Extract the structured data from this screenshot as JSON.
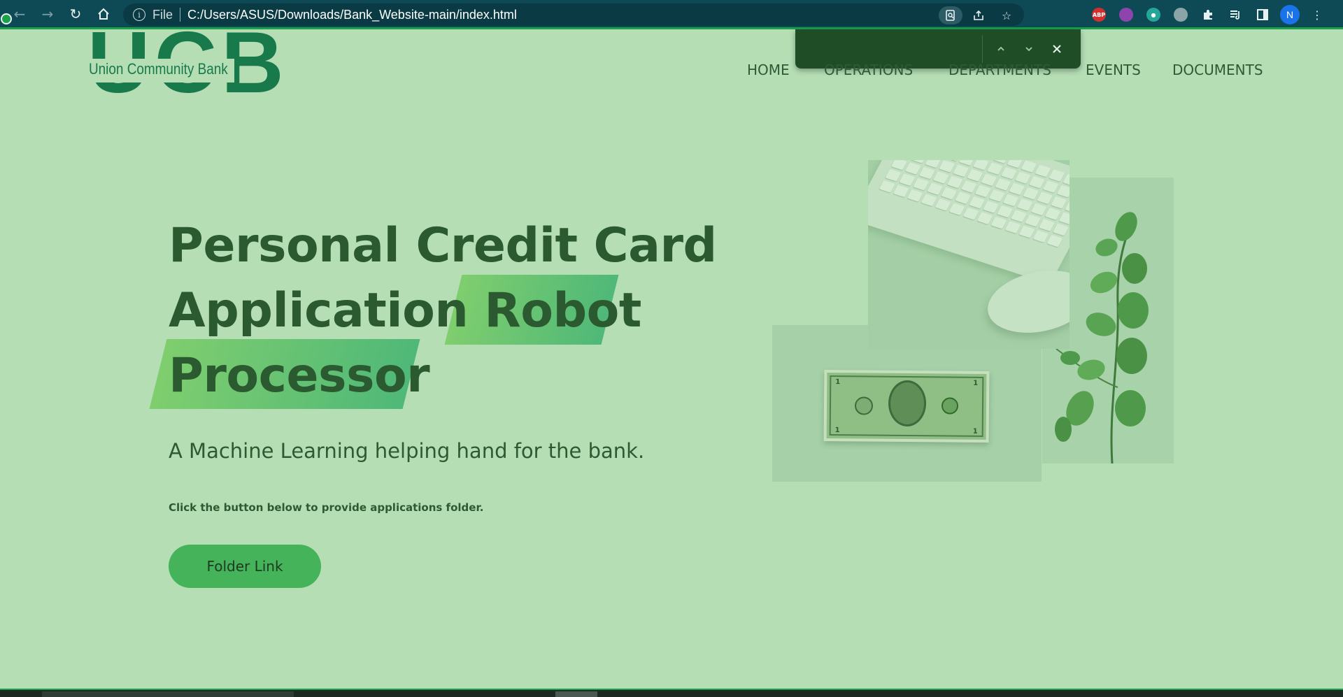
{
  "browser": {
    "back_icon": "arrow-left-icon",
    "forward_icon": "arrow-right-icon",
    "reload_icon": "reload-icon",
    "home_icon": "home-icon",
    "url_scheme_label": "File",
    "url": "C:/Users/ASUS/Downloads/Bank_Website-main/index.html",
    "profile_initial": "N",
    "extensions": [
      "ABP",
      "pocket",
      "lock",
      "globe",
      "puzzle",
      "media",
      "sidebar"
    ]
  },
  "find_bar": {
    "query": "",
    "prev_icon": "chevron-up-icon",
    "next_icon": "chevron-down-icon",
    "close_icon": "close-icon"
  },
  "site": {
    "logo_letters": "UCB",
    "logo_name": "Union Community Bank",
    "nav": [
      "HOME",
      "OPERATIONS",
      "DEPARTMENTS",
      "EVENTS",
      "DOCUMENTS"
    ]
  },
  "hero": {
    "title_line1": "Personal Credit Card",
    "title_line2_plain": "Application",
    "title_line2_highlight": "Robot",
    "title_line3_highlight": "Processor",
    "subtitle": "A Machine Learning helping hand for the bank.",
    "instruction": "Click the button below to provide applications folder.",
    "button_label": "Folder Link"
  },
  "colors": {
    "page_bg": "#b5deb5",
    "accent_green": "#45b35a",
    "title_color": "#2b5a30",
    "browser_bar": "#0e4a55"
  }
}
